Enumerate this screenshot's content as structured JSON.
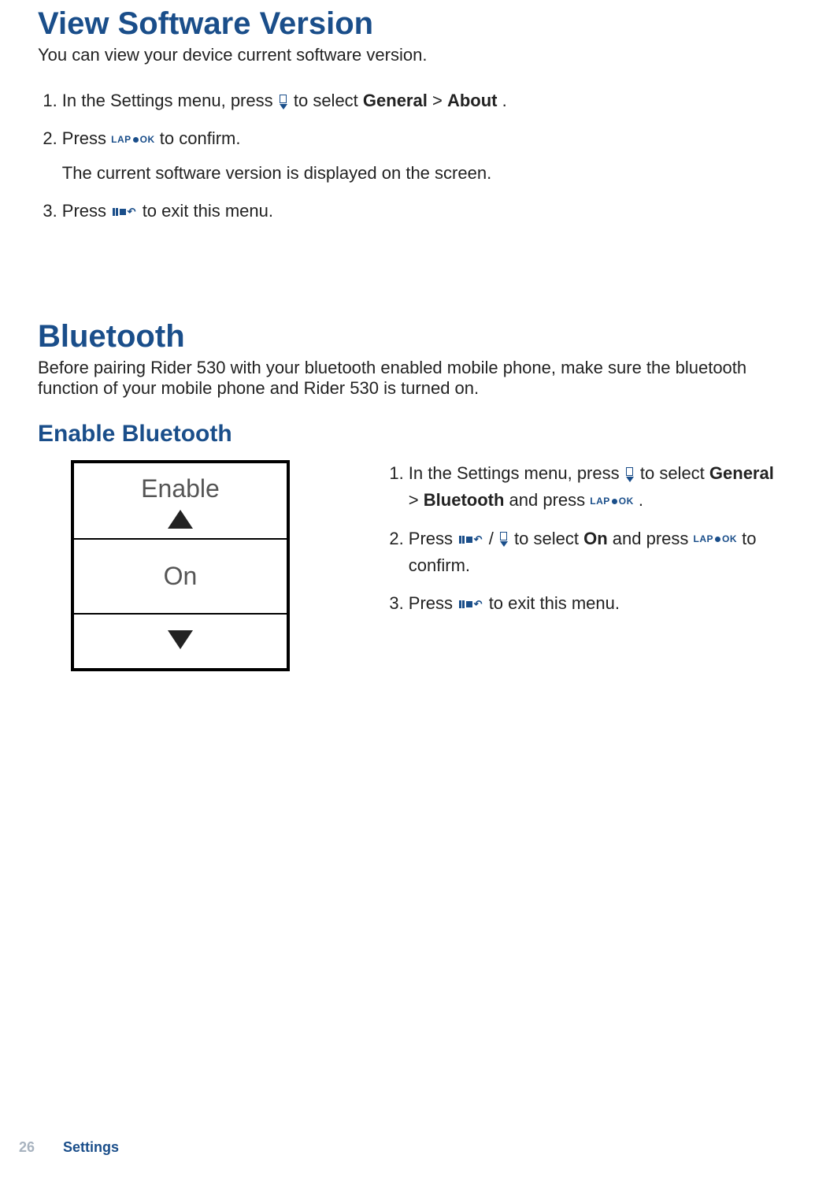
{
  "section1": {
    "heading": "View Software Version",
    "intro": "You can view your device current software version.",
    "steps": [
      {
        "before": "In the Settings menu, press ",
        "after_icon": " to select ",
        "bold1": "General",
        "sep": " > ",
        "bold2": "About",
        "tail": "."
      },
      {
        "before": "Press ",
        "after_icon": " to confirm.",
        "sub": "The current software version is displayed on the screen."
      },
      {
        "before": "Press ",
        "after_icon": " to exit this menu."
      }
    ]
  },
  "section2": {
    "heading": "Bluetooth",
    "intro": "Before pairing Rider 530 with your bluetooth enabled mobile phone, make sure the bluetooth function of your mobile phone and Rider 530 is turned on.",
    "subheading": "Enable Bluetooth",
    "device": {
      "title": "Enable",
      "value": "On"
    },
    "steps": [
      {
        "before": "In the Settings menu, press ",
        "after_icon": " to select ",
        "bold1": "General",
        "sep": " > ",
        "bold2": "Bluetooth",
        "mid": " and press ",
        "tail": " ."
      },
      {
        "before": "Press ",
        "slash": " / ",
        "after_icon": " to select ",
        "bold1": "On",
        "mid": " and press ",
        "tail2": " to confirm."
      },
      {
        "before": "Press ",
        "after_icon": " to exit this menu."
      }
    ]
  },
  "footer": {
    "page": "26",
    "section": "Settings"
  },
  "icons": {
    "lap": "LAP",
    "ok": "OK"
  }
}
